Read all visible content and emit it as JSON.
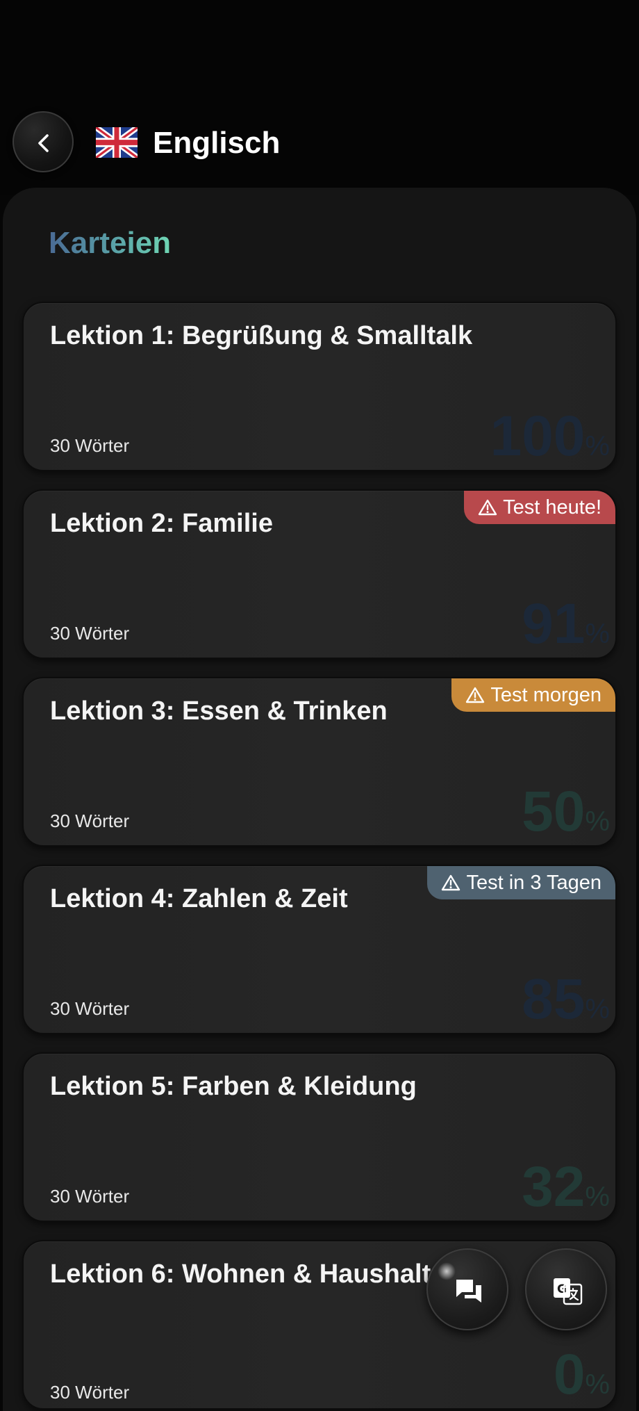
{
  "header": {
    "title": "Englisch",
    "flag_icon": "uk-flag-icon",
    "back_icon": "chevron-left-icon"
  },
  "section": {
    "title": "Karteien"
  },
  "colors": {
    "badge_today": "#b8494c",
    "badge_tomorrow": "#c98a3a",
    "badge_later": "#4f6270",
    "section_gradient_start": "#4a6a94",
    "section_gradient_end": "#6fd6b4"
  },
  "cards": [
    {
      "title": "Lektion 1: Begrüßung & Smalltalk",
      "count": "30 Wörter",
      "percent": "100",
      "percent_sign": "%",
      "badge": null
    },
    {
      "title": "Lektion 2: Familie",
      "count": "30 Wörter",
      "percent": "91",
      "percent_sign": "%",
      "badge": "Test heute!"
    },
    {
      "title": "Lektion 3: Essen & Trinken",
      "count": "30 Wörter",
      "percent": "50",
      "percent_sign": "%",
      "badge": "Test morgen"
    },
    {
      "title": "Lektion 4: Zahlen & Zeit",
      "count": "30 Wörter",
      "percent": "85",
      "percent_sign": "%",
      "badge": "Test in 3 Tagen"
    },
    {
      "title": "Lektion 5: Farben & Kleidung",
      "count": "30 Wörter",
      "percent": "32",
      "percent_sign": "%",
      "badge": null
    },
    {
      "title": "Lektion 6: Wohnen & Haushalt",
      "count": "30 Wörter",
      "percent": "0",
      "percent_sign": "%",
      "badge": null
    }
  ],
  "fabs": {
    "chat_icon": "chat-bubbles-icon",
    "translate_icon": "translate-icon"
  }
}
